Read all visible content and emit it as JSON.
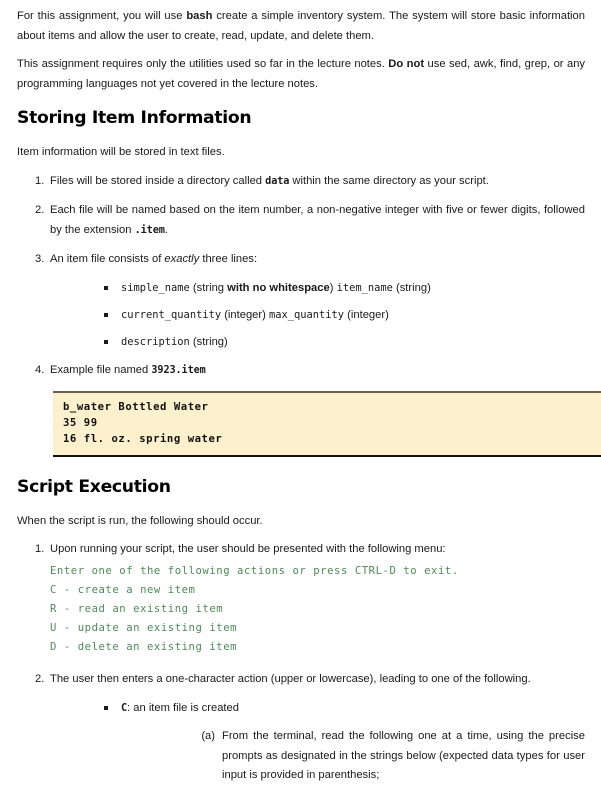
{
  "document": {
    "intro_paragraphs": [
      {
        "segments": [
          {
            "t": "For this assignment, you will use ",
            "s": "normal"
          },
          {
            "t": "bash",
            "s": "bold"
          },
          {
            "t": " create a simple inventory system. The system will store basic information about items and allow the user to create, read, update, and delete them.",
            "s": "normal"
          }
        ]
      },
      {
        "segments": [
          {
            "t": "This assignment requires only the utilities used so far in the lecture notes. ",
            "s": "normal"
          },
          {
            "t": "Do not",
            "s": "bold"
          },
          {
            "t": " use sed, awk, find, grep, or any programming languages not yet covered in the lecture notes.",
            "s": "normal"
          }
        ]
      }
    ],
    "section1": {
      "heading": "Storing Item Information",
      "lead": "Item information will be stored in text files.",
      "items": [
        {
          "marker": "1.",
          "pre": "Files will be stored inside a directory called ",
          "code": "data",
          "post": " within the same directory as your script."
        },
        {
          "marker": "2.",
          "pre": "Each file will be named based on the item number, a non-negative integer with five or fewer digits, followed by the extension ",
          "code": ".item",
          "post": "."
        },
        {
          "marker": "3.",
          "pre": "An item file consists of ",
          "italic": "exactly",
          "post": " three lines:"
        },
        {
          "marker": "4.",
          "pre": "Example file named ",
          "code": "3923.item",
          "post": ""
        }
      ],
      "line_bullets": [
        {
          "parts": [
            {
              "t": "simple_name",
              "s": "mono"
            },
            {
              "t": " (string ",
              "s": "normal"
            },
            {
              "t": "with no whitespace",
              "s": "bold"
            },
            {
              "t": ") ",
              "s": "normal"
            },
            {
              "t": "item_name",
              "s": "mono"
            },
            {
              "t": " (string)",
              "s": "normal"
            }
          ]
        },
        {
          "parts": [
            {
              "t": "current_quantity",
              "s": "mono"
            },
            {
              "t": " (integer) ",
              "s": "normal"
            },
            {
              "t": "max_quantity",
              "s": "mono"
            },
            {
              "t": " (integer)",
              "s": "normal"
            }
          ]
        },
        {
          "parts": [
            {
              "t": "description",
              "s": "mono"
            },
            {
              "t": " (string)",
              "s": "normal"
            }
          ]
        }
      ],
      "example_file": {
        "line1": "b_water Bottled Water",
        "line2": "35 99",
        "line3": "16 fl. oz. spring water"
      }
    },
    "section2": {
      "heading": "Script Execution",
      "lead": "When the script is run, the following should occur.",
      "item1": {
        "marker": "1.",
        "text": "Upon running your script, the user should be presented with the following menu:"
      },
      "menu_lines": [
        "Enter one of the following actions or press CTRL-D to exit.",
        "C - create a new item",
        "R - read an existing item",
        "U - update an existing item",
        "D - delete an existing item"
      ],
      "item2": {
        "marker": "2.",
        "text": "The user then enters a one-character action (upper or lowercase), leading to one of the following."
      },
      "bullet_c": {
        "code": "C",
        "text": ": an item file is created"
      },
      "sub_a": {
        "marker": "(a)",
        "text": "From the terminal, read the following one at a time, using the precise prompts as designated in the strings below (expected data types for user input is provided in parenthesis;"
      }
    }
  },
  "colors": {
    "terminal_green": "#4d8b57",
    "code_background": "#fdf0cd",
    "code_rule_top": "#6b6055",
    "code_rule_bottom": "#111111",
    "text": "#1a1a1a"
  }
}
